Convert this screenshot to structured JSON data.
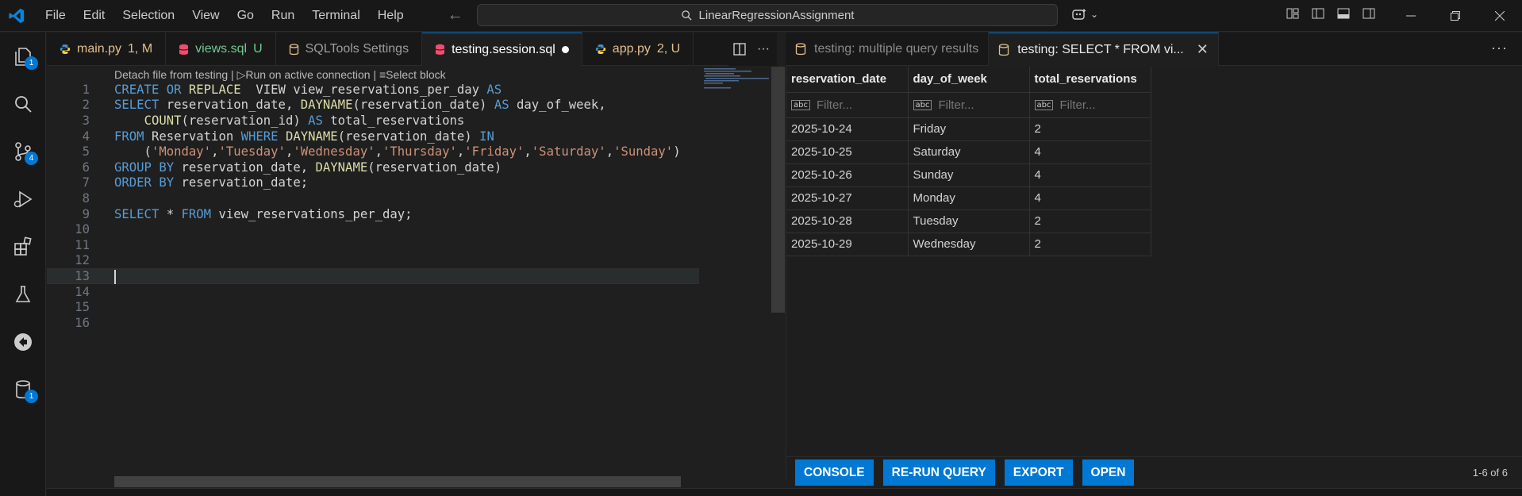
{
  "titlebar": {
    "menu": [
      "File",
      "Edit",
      "Selection",
      "View",
      "Go",
      "Run",
      "Terminal",
      "Help"
    ],
    "search_text": "LinearRegressionAssignment"
  },
  "activity_bar": {
    "items": [
      {
        "icon": "explorer-icon",
        "badge": "1"
      },
      {
        "icon": "search-icon",
        "badge": ""
      },
      {
        "icon": "source-control-icon",
        "badge": "4"
      },
      {
        "icon": "run-debug-icon",
        "badge": ""
      },
      {
        "icon": "extensions-icon",
        "badge": ""
      },
      {
        "icon": "testing-flask-icon",
        "badge": ""
      },
      {
        "icon": "remote-explorer-icon",
        "badge": ""
      },
      {
        "icon": "database-icon",
        "badge": "1"
      }
    ]
  },
  "editor_tabs": [
    {
      "label": "main.py",
      "status": "1, M",
      "kind": "python",
      "state": "modified"
    },
    {
      "label": "views.sql",
      "status": "U",
      "kind": "sql",
      "state": "untracked"
    },
    {
      "label": "SQLTools Settings",
      "status": "",
      "kind": "db",
      "state": "normal"
    },
    {
      "label": "testing.session.sql",
      "status": "",
      "kind": "sql",
      "state": "active"
    },
    {
      "label": "app.py",
      "status": "2, U",
      "kind": "python",
      "state": "modified"
    }
  ],
  "codelens": "Detach file from testing | ▷Run on active connection | ≡Select block",
  "code_lines": [
    {
      "n": "1",
      "tokens": [
        [
          "kw",
          "CREATE OR "
        ],
        [
          "fn",
          "REPLACE"
        ],
        [
          "",
          "  VIEW view_reservations_per_day "
        ],
        [
          "kw",
          "AS"
        ]
      ]
    },
    {
      "n": "2",
      "tokens": [
        [
          "kw",
          "SELECT"
        ],
        [
          "",
          " reservation_date, "
        ],
        [
          "fn",
          "DAYNAME"
        ],
        [
          "",
          "(reservation_date) "
        ],
        [
          "kw",
          "AS"
        ],
        [
          "",
          " day_of_week,"
        ]
      ]
    },
    {
      "n": "3",
      "tokens": [
        [
          "",
          "    "
        ],
        [
          "fn",
          "COUNT"
        ],
        [
          "",
          "(reservation_id) "
        ],
        [
          "kw",
          "AS"
        ],
        [
          "",
          " total_reservations"
        ]
      ]
    },
    {
      "n": "4",
      "tokens": [
        [
          "kw",
          "FROM"
        ],
        [
          "",
          " Reservation "
        ],
        [
          "kw",
          "WHERE"
        ],
        [
          "",
          " "
        ],
        [
          "fn",
          "DAYNAME"
        ],
        [
          "",
          "(reservation_date) "
        ],
        [
          "kw",
          "IN"
        ]
      ]
    },
    {
      "n": "5",
      "tokens": [
        [
          "",
          "    ("
        ],
        [
          "str",
          "'Monday'"
        ],
        [
          "",
          ","
        ],
        [
          "str",
          "'Tuesday'"
        ],
        [
          "",
          ","
        ],
        [
          "str",
          "'Wednesday'"
        ],
        [
          "",
          ","
        ],
        [
          "str",
          "'Thursday'"
        ],
        [
          "",
          ","
        ],
        [
          "str",
          "'Friday'"
        ],
        [
          "",
          ","
        ],
        [
          "str",
          "'Saturday'"
        ],
        [
          "",
          ","
        ],
        [
          "str",
          "'Sunday'"
        ],
        [
          "",
          ")"
        ]
      ]
    },
    {
      "n": "6",
      "tokens": [
        [
          "kw",
          "GROUP BY"
        ],
        [
          "",
          " reservation_date, "
        ],
        [
          "fn",
          "DAYNAME"
        ],
        [
          "",
          "(reservation_date)"
        ]
      ]
    },
    {
      "n": "7",
      "tokens": [
        [
          "kw",
          "ORDER BY"
        ],
        [
          "",
          " reservation_date;"
        ]
      ]
    },
    {
      "n": "8",
      "tokens": []
    },
    {
      "n": "9",
      "tokens": [
        [
          "kw",
          "SELECT"
        ],
        [
          "",
          " * "
        ],
        [
          "kw",
          "FROM"
        ],
        [
          "",
          " view_reservations_per_day;"
        ]
      ]
    },
    {
      "n": "10",
      "tokens": []
    },
    {
      "n": "11",
      "tokens": []
    },
    {
      "n": "12",
      "tokens": []
    },
    {
      "n": "13",
      "tokens": []
    },
    {
      "n": "14",
      "tokens": []
    },
    {
      "n": "15",
      "tokens": []
    },
    {
      "n": "16",
      "tokens": []
    }
  ],
  "result_tabs": [
    {
      "label": "testing: multiple query results",
      "active": false
    },
    {
      "label": "testing: SELECT * FROM vi...",
      "active": true
    }
  ],
  "results": {
    "columns": [
      "reservation_date",
      "day_of_week",
      "total_reservations"
    ],
    "filter_placeholder": "Filter...",
    "rows": [
      [
        "2025-10-24",
        "Friday",
        "2"
      ],
      [
        "2025-10-25",
        "Saturday",
        "4"
      ],
      [
        "2025-10-26",
        "Sunday",
        "4"
      ],
      [
        "2025-10-27",
        "Monday",
        "4"
      ],
      [
        "2025-10-28",
        "Tuesday",
        "2"
      ],
      [
        "2025-10-29",
        "Wednesday",
        "2"
      ]
    ],
    "buttons": [
      "CONSOLE",
      "RE-RUN QUERY",
      "EXPORT",
      "OPEN"
    ],
    "pager": "1-6 of 6"
  },
  "colors": {
    "accent": "#0078d4",
    "keyword": "#569cd6",
    "function": "#dcdcaa",
    "string": "#ce9178"
  }
}
